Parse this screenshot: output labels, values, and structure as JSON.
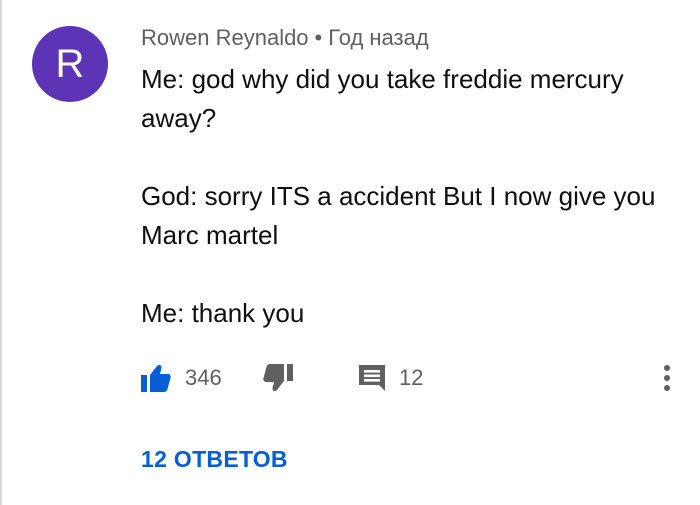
{
  "comment": {
    "avatar_letter": "R",
    "avatar_color": "#5c34b5",
    "author": "Rowen Reynaldo",
    "separator": "•",
    "timestamp": "Год назад",
    "lines": [
      "Me: god why did you take freddie mercury away?",
      "God: sorry ITS a accident But I now give you Marc martel",
      "Me: thank you"
    ]
  },
  "actions": {
    "like_icon": "thumbs-up-icon",
    "like_count": "346",
    "dislike_icon": "thumbs-down-icon",
    "reply_icon": "comment-icon",
    "reply_count": "12",
    "more_icon": "more-vertical-icon"
  },
  "replies": {
    "label": "12 ОТВЕТОВ",
    "color": "#065fd4"
  }
}
